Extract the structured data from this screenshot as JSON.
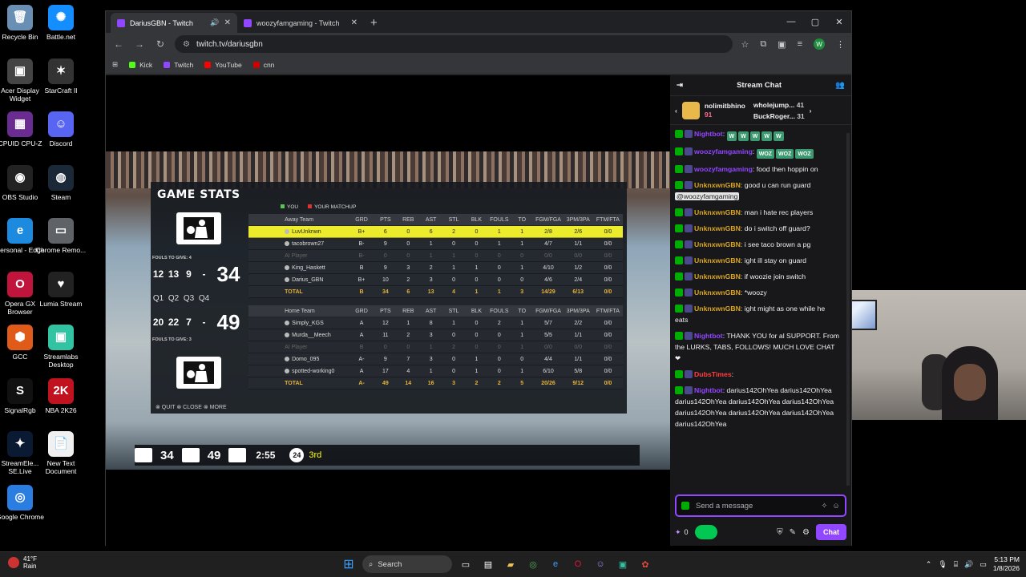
{
  "desktop": {
    "icons_left": [
      {
        "label": "Recycle Bin",
        "icon": "recycle-bin-icon",
        "color": "#6a8fb5",
        "glyph": "🗑"
      },
      {
        "label": "Acer Display Widget",
        "icon": "display-widget-icon",
        "color": "#444",
        "glyph": "▣"
      },
      {
        "label": "CPUID CPU-Z",
        "icon": "cpuz-icon",
        "color": "#6a2c91",
        "glyph": "▦"
      },
      {
        "label": "OBS Studio",
        "icon": "obs-icon",
        "color": "#222",
        "glyph": "◉"
      },
      {
        "label": "Personal - Edge",
        "icon": "edge-icon",
        "color": "#1b8adf",
        "glyph": "e"
      },
      {
        "label": "Opera GX Browser",
        "icon": "opera-gx-icon",
        "color": "#c0143c",
        "glyph": "O"
      },
      {
        "label": "GCC",
        "icon": "gcc-icon",
        "color": "#e05a1a",
        "glyph": "⬢"
      },
      {
        "label": "SignalRgb",
        "icon": "signalrgb-icon",
        "color": "#111",
        "glyph": "S"
      },
      {
        "label": "StreamEle... SE.Live",
        "icon": "streamelements-icon",
        "color": "#0b1a33",
        "glyph": "✦"
      },
      {
        "label": "Google Chrome",
        "icon": "chrome-icon",
        "color": "#2a7de1",
        "glyph": "◎"
      }
    ],
    "icons_right": [
      {
        "label": "Battle.net",
        "icon": "battlenet-icon",
        "color": "#148eff",
        "glyph": "✺"
      },
      {
        "label": "StarCraft II",
        "icon": "starcraft-icon",
        "color": "#333",
        "glyph": "✶"
      },
      {
        "label": "Discord",
        "icon": "discord-icon",
        "color": "#5865f2",
        "glyph": "☺"
      },
      {
        "label": "Steam",
        "icon": "steam-icon",
        "color": "#1b2838",
        "glyph": "◍"
      },
      {
        "label": "Chrome Remo...",
        "icon": "chrome-remote-icon",
        "color": "#5f6368",
        "glyph": "▭"
      },
      {
        "label": "Lumia Stream",
        "icon": "lumia-icon",
        "color": "#222",
        "glyph": "♥"
      },
      {
        "label": "Streamlabs Desktop",
        "icon": "streamlabs-icon",
        "color": "#31c3a2",
        "glyph": "▣"
      },
      {
        "label": "NBA 2K26",
        "icon": "nba2k-icon",
        "color": "#c1121f",
        "glyph": "2K"
      },
      {
        "label": "New Text Document",
        "icon": "text-document-icon",
        "color": "#f0f0f0",
        "glyph": "📄"
      }
    ]
  },
  "browser": {
    "tabs": [
      {
        "title": "DariusGBN - Twitch",
        "active": true,
        "has_audio": true
      },
      {
        "title": "woozyfamgaming - Twitch",
        "active": false,
        "has_audio": false
      }
    ],
    "url": "twitch.tv/dariusgbn",
    "bookmarks": [
      {
        "label": "Kick",
        "color": "#53fc18"
      },
      {
        "label": "Twitch",
        "color": "#9146ff"
      },
      {
        "label": "YouTube",
        "color": "#ff0000"
      },
      {
        "label": "cnn",
        "color": "#cc0000"
      }
    ],
    "profile_initial": "W"
  },
  "game": {
    "title": "GAME STATS",
    "legend_you": "YOU",
    "legend_matchup": "YOUR MATCHUP",
    "away_fouls": "FOULS TO GIVE: 4",
    "home_fouls": "FOULS TO GIVE: 3",
    "away_quarters": [
      "12",
      "13",
      "9",
      "-"
    ],
    "away_total": "34",
    "home_quarters": [
      "20",
      "22",
      "7",
      "-"
    ],
    "home_total": "49",
    "quarter_labels": [
      "Q1",
      "Q2",
      "Q3",
      "Q4"
    ],
    "columns": [
      "GRD",
      "PTS",
      "REB",
      "AST",
      "STL",
      "BLK",
      "FOULS",
      "TO",
      "FGM/FGA",
      "3PM/3PA",
      "FTM/FTA"
    ],
    "away_team_label": "Away Team",
    "home_team_label": "Home Team",
    "away_rows": [
      {
        "name": "LuvUnknwn",
        "grd": "B+",
        "pts": "6",
        "reb": "0",
        "ast": "6",
        "stl": "2",
        "blk": "0",
        "fouls": "1",
        "to": "1",
        "fg": "2/8",
        "tp": "2/6",
        "ft": "0/0",
        "highlight": true
      },
      {
        "name": "tacobrown27",
        "grd": "B-",
        "pts": "9",
        "reb": "0",
        "ast": "1",
        "stl": "0",
        "blk": "0",
        "fouls": "1",
        "to": "1",
        "fg": "4/7",
        "tp": "1/1",
        "ft": "0/0"
      },
      {
        "name": "AI Player",
        "grd": "B-",
        "pts": "0",
        "reb": "0",
        "ast": "1",
        "stl": "1",
        "blk": "0",
        "fouls": "0",
        "to": "0",
        "fg": "0/0",
        "tp": "0/0",
        "ft": "0/0",
        "ai": true
      },
      {
        "name": "King_Haskett",
        "grd": "B",
        "pts": "9",
        "reb": "3",
        "ast": "2",
        "stl": "1",
        "blk": "1",
        "fouls": "0",
        "to": "1",
        "fg": "4/10",
        "tp": "1/2",
        "ft": "0/0"
      },
      {
        "name": "Darius_GBN",
        "grd": "B+",
        "pts": "10",
        "reb": "2",
        "ast": "3",
        "stl": "0",
        "blk": "0",
        "fouls": "0",
        "to": "0",
        "fg": "4/6",
        "tp": "2/4",
        "ft": "0/0"
      }
    ],
    "away_total_row": {
      "name": "TOTAL",
      "grd": "B",
      "pts": "34",
      "reb": "6",
      "ast": "13",
      "stl": "4",
      "blk": "1",
      "fouls": "1",
      "to": "3",
      "fg": "14/29",
      "tp": "6/13",
      "ft": "0/0"
    },
    "home_rows": [
      {
        "name": "Simply_KGS",
        "grd": "A",
        "pts": "12",
        "reb": "1",
        "ast": "8",
        "stl": "1",
        "blk": "0",
        "fouls": "2",
        "to": "1",
        "fg": "5/7",
        "tp": "2/2",
        "ft": "0/0"
      },
      {
        "name": "Murda__Meech",
        "grd": "A",
        "pts": "11",
        "reb": "2",
        "ast": "3",
        "stl": "0",
        "blk": "0",
        "fouls": "0",
        "to": "1",
        "fg": "5/5",
        "tp": "1/1",
        "ft": "0/0"
      },
      {
        "name": "AI Player",
        "grd": "B",
        "pts": "0",
        "reb": "0",
        "ast": "1",
        "stl": "2",
        "blk": "0",
        "fouls": "0",
        "to": "1",
        "fg": "0/0",
        "tp": "0/0",
        "ft": "0/0",
        "ai": true
      },
      {
        "name": "Domo_095",
        "grd": "A-",
        "pts": "9",
        "reb": "7",
        "ast": "3",
        "stl": "0",
        "blk": "1",
        "fouls": "0",
        "to": "0",
        "fg": "4/4",
        "tp": "1/1",
        "ft": "0/0"
      },
      {
        "name": "spotted-working0",
        "grd": "A",
        "pts": "17",
        "reb": "4",
        "ast": "1",
        "stl": "0",
        "blk": "1",
        "fouls": "0",
        "to": "1",
        "fg": "6/10",
        "tp": "5/8",
        "ft": "0/0"
      }
    ],
    "home_total_row": {
      "name": "TOTAL",
      "grd": "A-",
      "pts": "49",
      "reb": "14",
      "ast": "16",
      "stl": "3",
      "blk": "2",
      "fouls": "2",
      "to": "5",
      "fg": "20/26",
      "tp": "9/12",
      "ft": "0/0"
    },
    "footer": "⊗ QUIT  ⊗ CLOSE  ⊗ MORE",
    "scorebug": {
      "away": "34",
      "home": "49",
      "clock": "2:55",
      "shot": "24",
      "period": "3rd"
    }
  },
  "chat": {
    "header": "Stream Chat",
    "gifters": [
      {
        "name": "nolimitbhino",
        "count": "91"
      },
      {
        "name": "wholejump...",
        "count": "41"
      },
      {
        "name": "BuckRoger...",
        "count": "31"
      }
    ],
    "messages": [
      {
        "user": "Nightbot",
        "color": "#9146ff",
        "text": "",
        "emotes": [
          "W",
          "W",
          "W",
          "W",
          "W"
        ]
      },
      {
        "user": "woozyfamgaming",
        "color": "#9146ff",
        "text": "",
        "emotes": [
          "WOZ",
          "WOZ",
          "WOZ"
        ]
      },
      {
        "user": "woozyfamgaming",
        "color": "#9146ff",
        "text": "food then hoppin on"
      },
      {
        "user": "UnknxwnGBN",
        "color": "#daa520",
        "text": "good u can run guard",
        "mention": "@woozyfamgaming"
      },
      {
        "user": "UnknxwnGBN",
        "color": "#daa520",
        "text": "man i hate rec players"
      },
      {
        "user": "UnknxwnGBN",
        "color": "#daa520",
        "text": "do i switch off guard?"
      },
      {
        "user": "UnknxwnGBN",
        "color": "#daa520",
        "text": "i see taco brown a pg"
      },
      {
        "user": "UnknxwnGBN",
        "color": "#daa520",
        "text": "ight ill stay on guard"
      },
      {
        "user": "UnknxwnGBN",
        "color": "#daa520",
        "text": "if woozie join switch"
      },
      {
        "user": "UnknxwnGBN",
        "color": "#daa520",
        "text": "*woozy"
      },
      {
        "user": "UnknxwnGBN",
        "color": "#daa520",
        "text": "ight might as one while he eats"
      },
      {
        "user": "Nightbot",
        "color": "#9146ff",
        "text": "THANK YOU for al SUPPORT. From the LURKS, TABS, FOLLOWS! MUCH LOVE CHAT ❤"
      },
      {
        "user": "DubsTimes",
        "color": "#ff4040",
        "text": ""
      },
      {
        "user": "Nightbot",
        "color": "#9146ff",
        "text": "darius142OhYea darius142OhYea darius142OhYea darius142OhYea darius142OhYea darius142OhYea darius142OhYea darius142OhYea darius142OhYea"
      }
    ],
    "input_placeholder": "Send a message",
    "points": "0",
    "chat_button": "Chat"
  },
  "taskbar": {
    "weather_temp": "41°F",
    "weather_cond": "Rain",
    "search_label": "Search",
    "time": "5:13 PM",
    "date": "1/8/2026"
  }
}
